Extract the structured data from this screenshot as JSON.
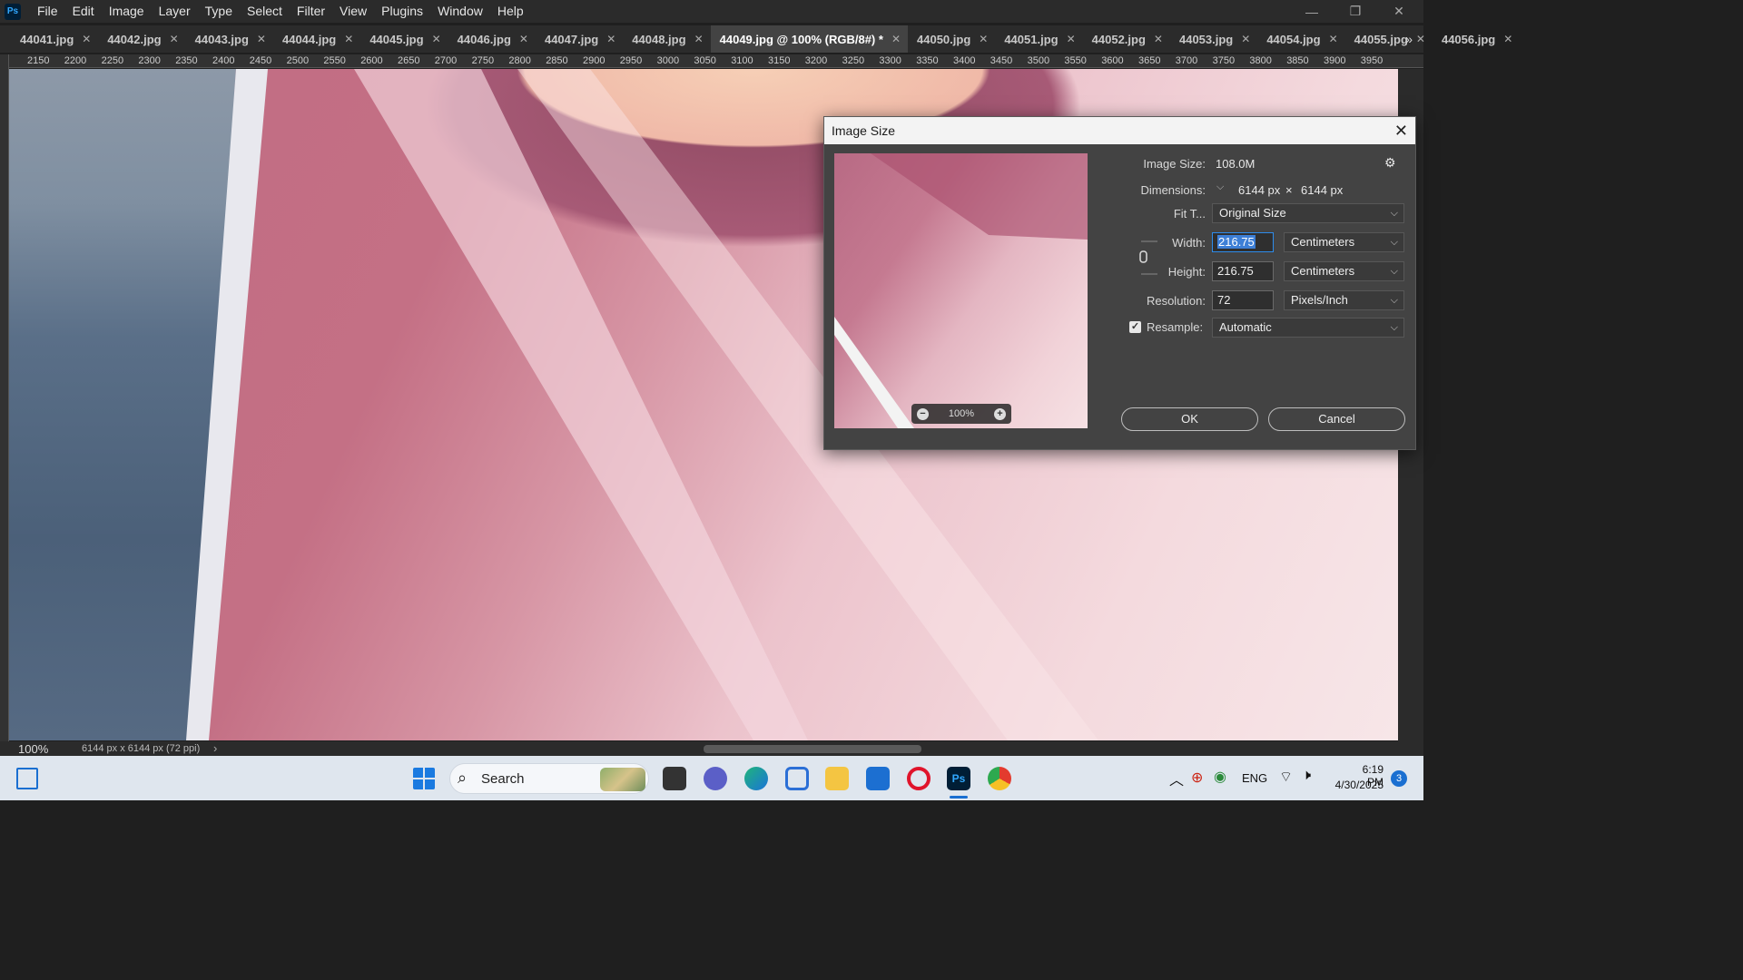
{
  "app": {
    "logo_text": "Ps"
  },
  "menu": [
    "File",
    "Edit",
    "Image",
    "Layer",
    "Type",
    "Select",
    "Filter",
    "View",
    "Plugins",
    "Window",
    "Help"
  ],
  "window_controls": {
    "minimize": "—",
    "restore": "❐",
    "close": "✕"
  },
  "tabs": [
    {
      "label": "44041.jpg"
    },
    {
      "label": "44042.jpg"
    },
    {
      "label": "44043.jpg"
    },
    {
      "label": "44044.jpg"
    },
    {
      "label": "44045.jpg"
    },
    {
      "label": "44046.jpg"
    },
    {
      "label": "44047.jpg"
    },
    {
      "label": "44048.jpg"
    },
    {
      "label": "44049.jpg @ 100% (RGB/8#) *",
      "active": true
    },
    {
      "label": "44050.jpg"
    },
    {
      "label": "44051.jpg"
    },
    {
      "label": "44052.jpg"
    },
    {
      "label": "44053.jpg"
    },
    {
      "label": "44054.jpg"
    },
    {
      "label": "44055.jpg"
    },
    {
      "label": "44056.jpg"
    }
  ],
  "tab_overflow": "»",
  "ruler_top": [
    "2150",
    "2200",
    "2250",
    "2300",
    "2350",
    "2400",
    "2450",
    "2500",
    "2550",
    "2600",
    "2650",
    "2700",
    "2750",
    "2800",
    "2850",
    "2900",
    "2950",
    "3000",
    "3050",
    "3100",
    "3150",
    "3200",
    "3250",
    "3300",
    "3350",
    "3400",
    "3450",
    "3500",
    "3550",
    "3600",
    "3650",
    "3700",
    "3750",
    "3800",
    "3850",
    "3900",
    "3950"
  ],
  "status": {
    "zoom": "100%",
    "doc_info": "6144 px x 6144 px (72 ppi)",
    "arrow": "›"
  },
  "dialog": {
    "title": "Image Size",
    "close": "✕",
    "preview_zoom": "100%",
    "image_size_label": "Image Size:",
    "image_size_value": "108.0M",
    "dimensions_label": "Dimensions:",
    "dimensions_w": "6144 px",
    "dimensions_x": "×",
    "dimensions_h": "6144 px",
    "fit_to_label": "Fit T...",
    "fit_to_value": "Original Size",
    "width_label": "Width:",
    "width_value": "216.75",
    "width_unit": "Centimeters",
    "height_label": "Height:",
    "height_value": "216.75",
    "height_unit": "Centimeters",
    "resolution_label": "Resolution:",
    "resolution_value": "72",
    "resolution_unit": "Pixels/Inch",
    "resample_label": "Resample:",
    "resample_checked": true,
    "resample_value": "Automatic",
    "ok_label": "OK",
    "cancel_label": "Cancel"
  },
  "taskbar": {
    "search_label": "Search",
    "lang": "ENG",
    "time": "6:19 PM",
    "date": "4/30/2025",
    "notifications": "3"
  }
}
